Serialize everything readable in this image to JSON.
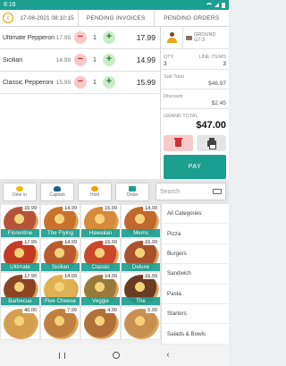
{
  "status_bar": {
    "time": "8:16"
  },
  "top_bar": {
    "datetime": "17-08-2021 08:10:15",
    "tabs": [
      {
        "label": "PENDING INVOICES"
      },
      {
        "label": "PENDING ORDERS"
      }
    ]
  },
  "order_items": [
    {
      "name": "Ultimate Pepperoni",
      "unit_price": "17.99",
      "qty": "1",
      "total": "17.99"
    },
    {
      "name": "Sicilian",
      "unit_price": "14.99",
      "qty": "1",
      "total": "14.99"
    },
    {
      "name": "Classic Pepperoni",
      "unit_price": "15.99",
      "qty": "1",
      "total": "15.99"
    }
  ],
  "order_type": {
    "line1": "GROUND",
    "line2": "GT-3"
  },
  "summary": {
    "qty_label": "QTY",
    "qty_value": "3",
    "line_items_label": "LINE ITEMS",
    "line_items_value": "3",
    "subtotal_label": "Sub Total",
    "subtotal_value": "$46.97",
    "discount_label": "Discount",
    "discount_value": "$2.45",
    "grand_total_label": "GRAND TOTAL",
    "grand_total_value": "$47.00",
    "pay_label": "PAY"
  },
  "toolbar": {
    "buttons": [
      {
        "label": "Dine In",
        "icon": "dine-in-icon"
      },
      {
        "label": "Captain",
        "icon": "captain-icon"
      },
      {
        "label": "Hold",
        "icon": "hold-icon"
      },
      {
        "label": "Order",
        "icon": "order-icon"
      }
    ],
    "search_placeholder": "Search"
  },
  "products": [
    {
      "name": "Florentine",
      "price": "15.99",
      "color": "#b5543a"
    },
    {
      "name": "The Flying",
      "price": "14.99",
      "color": "#c9722e"
    },
    {
      "name": "Hawaiian",
      "price": "15.99",
      "color": "#d68a3c"
    },
    {
      "name": "Mems",
      "price": "14.99",
      "color": "#c0692f"
    },
    {
      "name": "Ultimate",
      "price": "17.99",
      "color": "#c23b22"
    },
    {
      "name": "Sicilian",
      "price": "14.99",
      "color": "#b85a2e"
    },
    {
      "name": "Classic",
      "price": "15.99",
      "color": "#c9472b"
    },
    {
      "name": "Deluxe",
      "price": "15.99",
      "color": "#a8522d"
    },
    {
      "name": "Barbecue",
      "price": "17.99",
      "color": "#8a4527"
    },
    {
      "name": "Five Cheese",
      "price": "14.99",
      "color": "#e0b153"
    },
    {
      "name": "Veggie",
      "price": "14.99",
      "color": "#9a7a3a"
    },
    {
      "name": "The",
      "price": "15.99",
      "color": "#6b3b24"
    },
    {
      "name": "",
      "price": "40.00",
      "color": "#d4a050"
    },
    {
      "name": "",
      "price": "7.99",
      "color": "#c08040"
    },
    {
      "name": "",
      "price": "4.99",
      "color": "#b0703a"
    },
    {
      "name": "",
      "price": "5.99",
      "color": "#c89050"
    }
  ],
  "categories": [
    {
      "label": "All Categories"
    },
    {
      "label": "Pizza"
    },
    {
      "label": "Burgers"
    },
    {
      "label": "Sandwich"
    },
    {
      "label": "Pasta"
    },
    {
      "label": "Starters"
    },
    {
      "label": "Salads & Bowls"
    }
  ],
  "colors": {
    "accent": "#1c9e90",
    "minus": "#d32f2f",
    "plus": "#2e7d32"
  }
}
